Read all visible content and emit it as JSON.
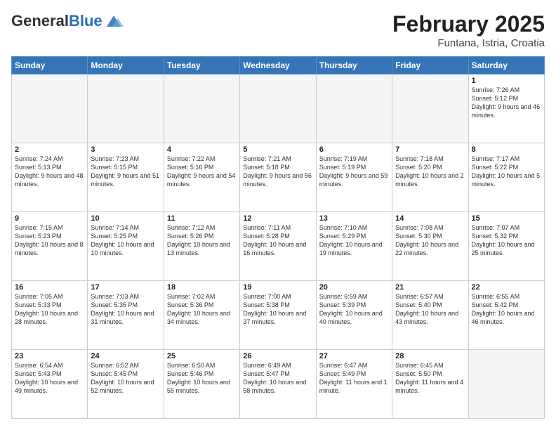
{
  "header": {
    "logo_general": "General",
    "logo_blue": "Blue",
    "month_title": "February 2025",
    "location": "Funtana, Istria, Croatia"
  },
  "calendar": {
    "days_of_week": [
      "Sunday",
      "Monday",
      "Tuesday",
      "Wednesday",
      "Thursday",
      "Friday",
      "Saturday"
    ],
    "weeks": [
      [
        {
          "day": "",
          "info": "",
          "empty": true
        },
        {
          "day": "",
          "info": "",
          "empty": true
        },
        {
          "day": "",
          "info": "",
          "empty": true
        },
        {
          "day": "",
          "info": "",
          "empty": true
        },
        {
          "day": "",
          "info": "",
          "empty": true
        },
        {
          "day": "",
          "info": "",
          "empty": true
        },
        {
          "day": "1",
          "info": "Sunrise: 7:26 AM\nSunset: 5:12 PM\nDaylight: 9 hours and 46 minutes."
        }
      ],
      [
        {
          "day": "2",
          "info": "Sunrise: 7:24 AM\nSunset: 5:13 PM\nDaylight: 9 hours and 48 minutes."
        },
        {
          "day": "3",
          "info": "Sunrise: 7:23 AM\nSunset: 5:15 PM\nDaylight: 9 hours and 51 minutes."
        },
        {
          "day": "4",
          "info": "Sunrise: 7:22 AM\nSunset: 5:16 PM\nDaylight: 9 hours and 54 minutes."
        },
        {
          "day": "5",
          "info": "Sunrise: 7:21 AM\nSunset: 5:18 PM\nDaylight: 9 hours and 56 minutes."
        },
        {
          "day": "6",
          "info": "Sunrise: 7:19 AM\nSunset: 5:19 PM\nDaylight: 9 hours and 59 minutes."
        },
        {
          "day": "7",
          "info": "Sunrise: 7:18 AM\nSunset: 5:20 PM\nDaylight: 10 hours and 2 minutes."
        },
        {
          "day": "8",
          "info": "Sunrise: 7:17 AM\nSunset: 5:22 PM\nDaylight: 10 hours and 5 minutes."
        }
      ],
      [
        {
          "day": "9",
          "info": "Sunrise: 7:15 AM\nSunset: 5:23 PM\nDaylight: 10 hours and 8 minutes."
        },
        {
          "day": "10",
          "info": "Sunrise: 7:14 AM\nSunset: 5:25 PM\nDaylight: 10 hours and 10 minutes."
        },
        {
          "day": "11",
          "info": "Sunrise: 7:12 AM\nSunset: 5:26 PM\nDaylight: 10 hours and 13 minutes."
        },
        {
          "day": "12",
          "info": "Sunrise: 7:11 AM\nSunset: 5:28 PM\nDaylight: 10 hours and 16 minutes."
        },
        {
          "day": "13",
          "info": "Sunrise: 7:10 AM\nSunset: 5:29 PM\nDaylight: 10 hours and 19 minutes."
        },
        {
          "day": "14",
          "info": "Sunrise: 7:08 AM\nSunset: 5:30 PM\nDaylight: 10 hours and 22 minutes."
        },
        {
          "day": "15",
          "info": "Sunrise: 7:07 AM\nSunset: 5:32 PM\nDaylight: 10 hours and 25 minutes."
        }
      ],
      [
        {
          "day": "16",
          "info": "Sunrise: 7:05 AM\nSunset: 5:33 PM\nDaylight: 10 hours and 28 minutes."
        },
        {
          "day": "17",
          "info": "Sunrise: 7:03 AM\nSunset: 5:35 PM\nDaylight: 10 hours and 31 minutes."
        },
        {
          "day": "18",
          "info": "Sunrise: 7:02 AM\nSunset: 5:36 PM\nDaylight: 10 hours and 34 minutes."
        },
        {
          "day": "19",
          "info": "Sunrise: 7:00 AM\nSunset: 5:38 PM\nDaylight: 10 hours and 37 minutes."
        },
        {
          "day": "20",
          "info": "Sunrise: 6:59 AM\nSunset: 5:39 PM\nDaylight: 10 hours and 40 minutes."
        },
        {
          "day": "21",
          "info": "Sunrise: 6:57 AM\nSunset: 5:40 PM\nDaylight: 10 hours and 43 minutes."
        },
        {
          "day": "22",
          "info": "Sunrise: 6:55 AM\nSunset: 5:42 PM\nDaylight: 10 hours and 46 minutes."
        }
      ],
      [
        {
          "day": "23",
          "info": "Sunrise: 6:54 AM\nSunset: 5:43 PM\nDaylight: 10 hours and 49 minutes."
        },
        {
          "day": "24",
          "info": "Sunrise: 6:52 AM\nSunset: 5:45 PM\nDaylight: 10 hours and 52 minutes."
        },
        {
          "day": "25",
          "info": "Sunrise: 6:50 AM\nSunset: 5:46 PM\nDaylight: 10 hours and 55 minutes."
        },
        {
          "day": "26",
          "info": "Sunrise: 6:49 AM\nSunset: 5:47 PM\nDaylight: 10 hours and 58 minutes."
        },
        {
          "day": "27",
          "info": "Sunrise: 6:47 AM\nSunset: 5:49 PM\nDaylight: 11 hours and 1 minute."
        },
        {
          "day": "28",
          "info": "Sunrise: 6:45 AM\nSunset: 5:50 PM\nDaylight: 11 hours and 4 minutes."
        },
        {
          "day": "",
          "info": "",
          "empty": true
        }
      ]
    ]
  }
}
